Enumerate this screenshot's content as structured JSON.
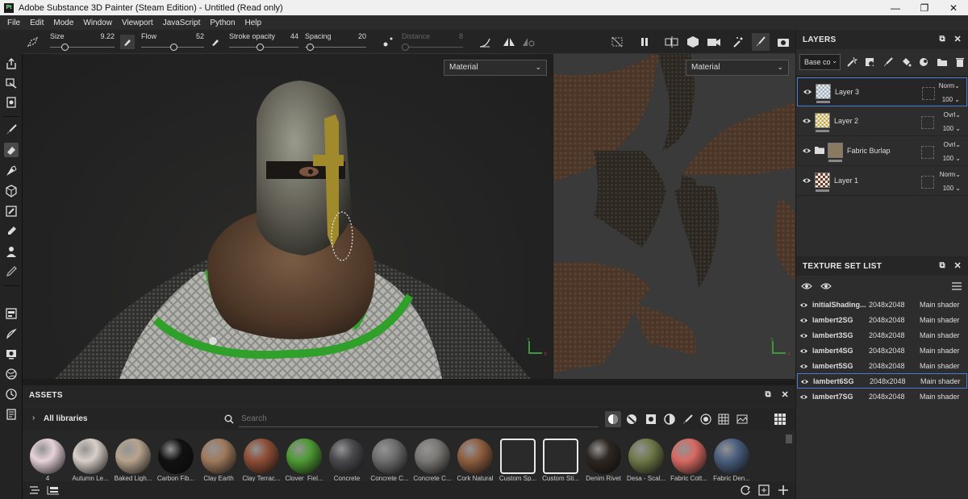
{
  "window": {
    "title": "Adobe Substance 3D Painter (Steam Edition) - Untitled (Read only)",
    "logo": "Pt"
  },
  "menu": [
    "File",
    "Edit",
    "Mode",
    "Window",
    "Viewport",
    "JavaScript",
    "Python",
    "Help"
  ],
  "toolbar": {
    "size": {
      "label": "Size",
      "value": "9.22",
      "level": 0.2
    },
    "flow": {
      "label": "Flow",
      "value": "52",
      "level": 0.52
    },
    "stroke_opacity": {
      "label": "Stroke opacity",
      "value": "44",
      "level": 0.44
    },
    "spacing": {
      "label": "Spacing",
      "value": "20",
      "level": 0.03
    },
    "distance": {
      "label": "Distance",
      "value": "8",
      "level": 0.0
    }
  },
  "viewports": {
    "left_mode": "Material",
    "right_mode": "Material"
  },
  "layers": {
    "title": "LAYERS",
    "channel": "Base co",
    "items": [
      {
        "name": "Layer 3",
        "blend": "Norm",
        "opacity": "100",
        "thumb": "checker"
      },
      {
        "name": "Layer 2",
        "blend": "Ovrl",
        "opacity": "100",
        "thumb": "yellow-checker"
      },
      {
        "name": "Fabric Burlap",
        "blend": "Ovrl",
        "opacity": "100",
        "thumb": "burlap"
      },
      {
        "name": "Layer 1",
        "blend": "Norm",
        "opacity": "100",
        "thumb": "pattern"
      }
    ]
  },
  "texture_sets": {
    "title": "TEXTURE SET LIST",
    "items": [
      {
        "name": "initialShading...",
        "res": "2048x2048",
        "shader": "Main shader"
      },
      {
        "name": "lambert2SG",
        "res": "2048x2048",
        "shader": "Main shader"
      },
      {
        "name": "lambert3SG",
        "res": "2048x2048",
        "shader": "Main shader"
      },
      {
        "name": "lambert4SG",
        "res": "2048x2048",
        "shader": "Main shader"
      },
      {
        "name": "lambert5SG",
        "res": "2048x2048",
        "shader": "Main shader"
      },
      {
        "name": "lambert6SG",
        "res": "2048x2048",
        "shader": "Main shader"
      },
      {
        "name": "lambert7SG",
        "res": "2048x2048",
        "shader": "Main shader"
      }
    ]
  },
  "assets": {
    "title": "ASSETS",
    "library": "All libraries",
    "search_placeholder": "Search",
    "items": [
      {
        "label": "4",
        "color": "#e6d2d8"
      },
      {
        "label": "Autumn Le...",
        "color": "#d8cfc8"
      },
      {
        "label": "Baked Ligh...",
        "color": "#b8a48e"
      },
      {
        "label": "Carbon Fib...",
        "color": "#111111"
      },
      {
        "label": "Clay Earth",
        "color": "#a07a5c"
      },
      {
        "label": "Clay Terrac...",
        "color": "#8e4e36"
      },
      {
        "label": "Clover_Fiel...",
        "color": "#4e9a34"
      },
      {
        "label": "Concrete",
        "color": "#4a4a4e"
      },
      {
        "label": "Concrete C...",
        "color": "#6e6e6e"
      },
      {
        "label": "Concrete C...",
        "color": "#7a7874"
      },
      {
        "label": "Cork Natural",
        "color": "#8e5e40"
      },
      {
        "label": "Custom Sp...",
        "color": "#e8e8e8"
      },
      {
        "label": "Custom Sti...",
        "color": "#e8e8e8"
      },
      {
        "label": "Denim Rivet",
        "color": "#2e2620"
      },
      {
        "label": "Desa - Scal...",
        "color": "#6e7848"
      },
      {
        "label": "Fabric Cott...",
        "color": "#d86a62"
      },
      {
        "label": "Fabric Den...",
        "color": "#4a5e7e"
      }
    ]
  }
}
